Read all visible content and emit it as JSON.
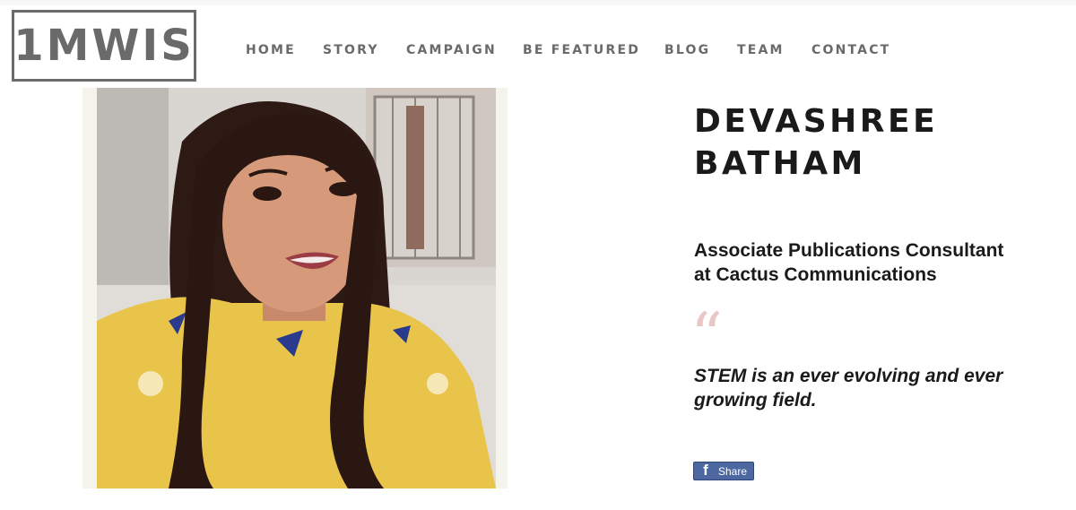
{
  "site": {
    "logo_text": "1MWIS"
  },
  "nav": {
    "items": [
      {
        "label": "HOME"
      },
      {
        "label": "STORY"
      },
      {
        "label": "CAMPAIGN"
      },
      {
        "label": "BE FEATURED"
      },
      {
        "label": "BLOG"
      },
      {
        "label": "TEAM"
      },
      {
        "label": "CONTACT"
      }
    ]
  },
  "profile": {
    "name_line1": "DEVASHREE",
    "name_line2": "BATHAM",
    "role_line1": "Associate Publications Consultant",
    "role_line2": "at Cactus Communications",
    "quote_mark": "“",
    "quote_line1": "STEM is an ever evolving and ever",
    "quote_line2": "growing field."
  },
  "share": {
    "icon": "facebook-icon",
    "label": "Share"
  },
  "colors": {
    "nav_text": "#6a6a6a",
    "heading_text": "#1a1a1a",
    "quote_mark": "#e9c7c7",
    "facebook_button": "#4d68a1"
  }
}
